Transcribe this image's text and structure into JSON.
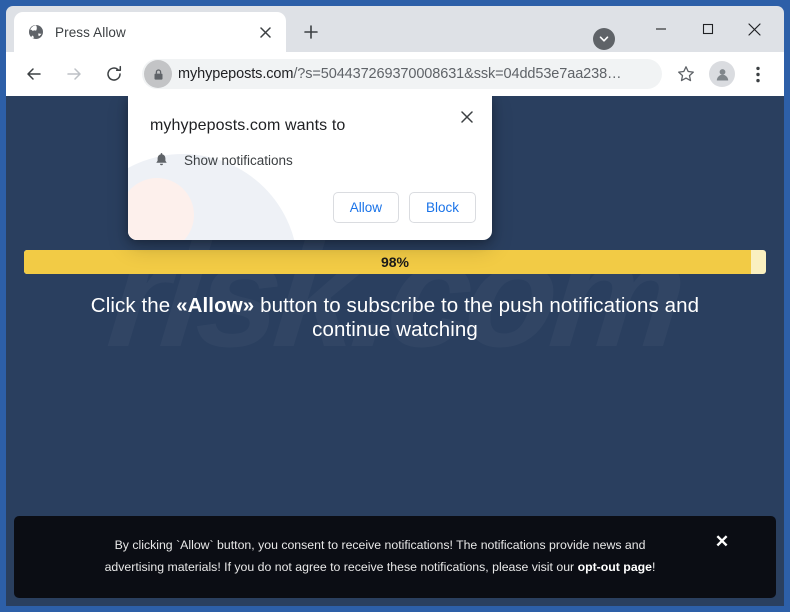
{
  "browser": {
    "tab": {
      "title": "Press Allow",
      "favicon": "globe-icon",
      "close_label": "×"
    },
    "new_tab_label": "+",
    "tab_search": "chevron-down-icon",
    "window_controls": {
      "minimize": "─",
      "maximize": "□",
      "close": "×"
    },
    "nav": {
      "back": "back-arrow-icon",
      "forward": "forward-arrow-icon",
      "reload": "reload-icon"
    },
    "omnibox": {
      "lock": "lock-icon",
      "url_host": "myhypeposts.com",
      "url_path": "/?s=504437269370008631&ssk=04dd53e7aa238…"
    },
    "toolbar": {
      "bookmark": "star-icon",
      "profile": "profile-avatar-icon",
      "menu": "three-dot-menu-icon"
    }
  },
  "dialog": {
    "title": "myhypeposts.com wants to",
    "close_label": "×",
    "permission_icon": "bell-icon",
    "permission_label": "Show notifications",
    "allow_label": "Allow",
    "block_label": "Block"
  },
  "page": {
    "watermark": "risk.com",
    "progress": {
      "value": 98,
      "label": "98%",
      "fill_color": "#f2cb45",
      "track_color": "#faf0c0"
    },
    "headline": {
      "before": "Click the ",
      "emphasis": "«Allow»",
      "after": " button to subscribe to the push notifications and continue watching"
    },
    "background_color": "#2a3f5f"
  },
  "consent_banner": {
    "line1": "By clicking `Allow` button, you consent to receive notifications! The notifications provide news and",
    "line2_before": "advertising materials! If you do not agree to receive these notifications, please visit our ",
    "line2_link": "opt-out page",
    "line2_after": "!",
    "close_label": "✕",
    "background_color": "#0b0d14"
  }
}
